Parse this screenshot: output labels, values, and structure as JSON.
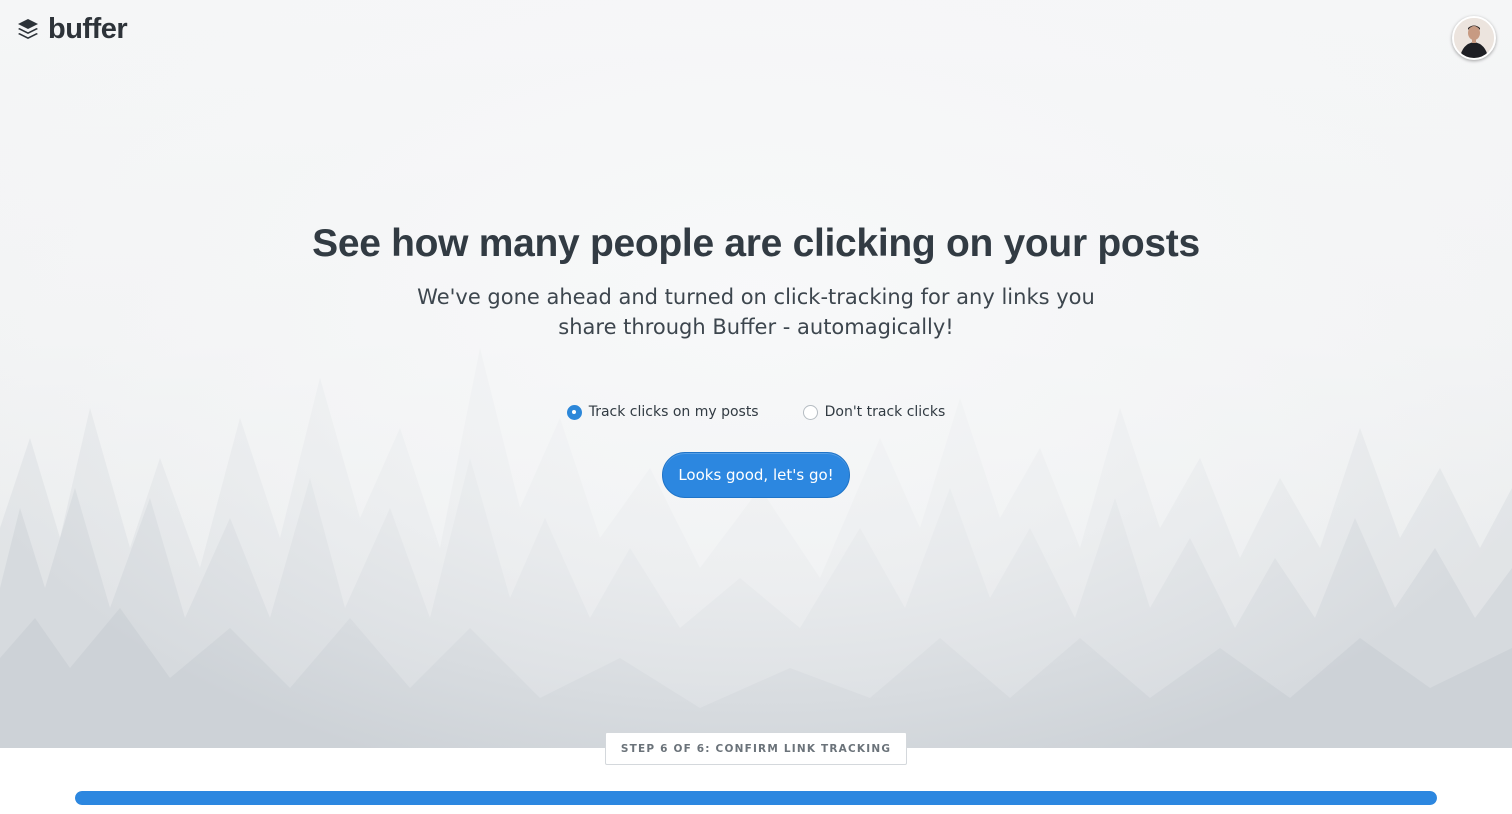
{
  "brand": {
    "logo_text": "buffer",
    "logo_icon": "layers-stack-icon",
    "accent_color": "#2c87e0"
  },
  "user": {
    "avatar_icon": "user-avatar"
  },
  "main": {
    "title": "See how many people are clicking on your posts",
    "subtitle": "We've gone ahead and turned on click-tracking for any links you share through Buffer - automagically!",
    "options": [
      {
        "label": "Track clicks on my posts",
        "selected": true
      },
      {
        "label": "Don't track clicks",
        "selected": false
      }
    ],
    "confirm_button": "Looks good, let's go!"
  },
  "footer": {
    "step_label": "STEP 6 OF 6: CONFIRM LINK TRACKING",
    "progress_percent": 100
  }
}
